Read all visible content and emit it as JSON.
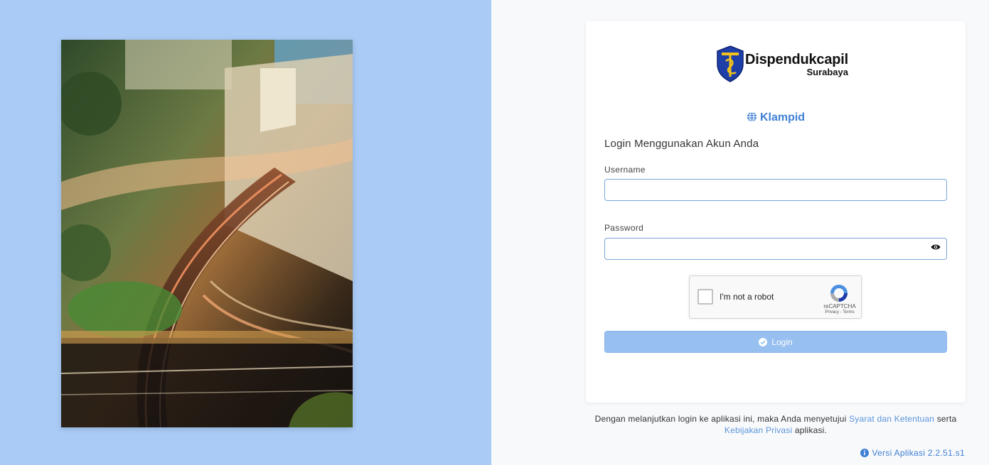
{
  "brand": {
    "name": "Dispendukcapil",
    "city": "Surabaya"
  },
  "location": {
    "icon": "globe-icon",
    "name": "Klampid"
  },
  "login_form": {
    "heading": "Login Menggunakan Akun Anda",
    "username_label": "Username",
    "username_value": "",
    "password_label": "Password",
    "password_value": "",
    "password_toggle_icon": "eye-icon",
    "submit_label": "Login",
    "submit_icon": "check-circle-icon"
  },
  "recaptcha": {
    "checkbox_label": "I'm not a robot",
    "brand": "reCAPTCHA",
    "links": "Privacy - Terms"
  },
  "footer": {
    "text_before": "Dengan melanjutkan login ke aplikasi ini, maka Anda menyetujui",
    "terms_link": "Syarat dan Ketentuan",
    "text_middle": "serta",
    "privacy_link": "Kebijakan Privasi",
    "text_after": "aplikasi."
  },
  "version": {
    "icon": "info-icon",
    "label": "Versi Aplikasi 2.2.51.s1"
  },
  "colors": {
    "left_background": "#a9cbf5",
    "accent": "#3f7fd4",
    "button_disabled": "#97bff0",
    "link": "#5b95dc"
  }
}
